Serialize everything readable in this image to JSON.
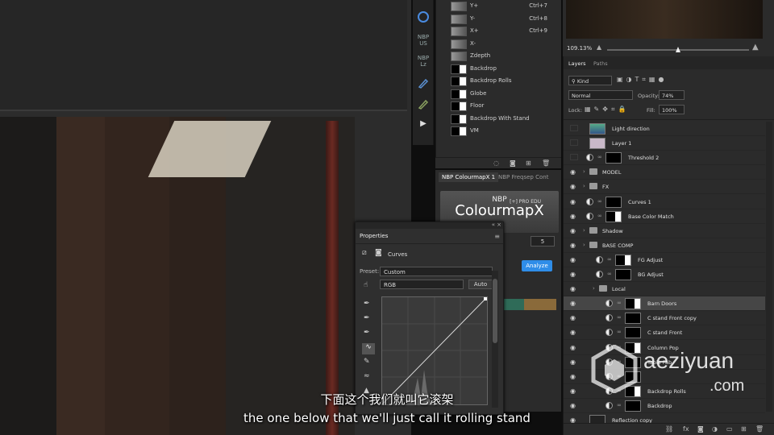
{
  "channels": [
    {
      "name": "Y+",
      "key": "Ctrl+7"
    },
    {
      "name": "Y-",
      "key": "Ctrl+8"
    },
    {
      "name": "X+",
      "key": "Ctrl+9"
    },
    {
      "name": "X-",
      "key": ""
    },
    {
      "name": "Zdepth",
      "key": ""
    },
    {
      "name": "Backdrop",
      "key": ""
    },
    {
      "name": "Backdrop Rolls",
      "key": ""
    },
    {
      "name": "Globe",
      "key": ""
    },
    {
      "name": "Floor",
      "key": ""
    },
    {
      "name": "Backdrop With Stand",
      "key": ""
    },
    {
      "name": "VM",
      "key": ""
    }
  ],
  "strip_tools": [
    "NBP US",
    "NBP Lz"
  ],
  "nbp": {
    "tab1": "NBP ColourmapX 1",
    "tab2": "NBP Freqsep Cont",
    "logo_top": "NBP",
    "logo_main": "ColourmapX",
    "logo_badge": "[+] PRO EDU",
    "value": "5",
    "analyze": "Analyze"
  },
  "properties": {
    "title": "Properties",
    "type": "Curves",
    "preset_label": "Preset:",
    "preset_value": "Custom",
    "channel": "RGB",
    "auto": "Auto"
  },
  "navigator": {
    "zoom": "109.13%"
  },
  "layers_panel": {
    "tab_layers": "Layers",
    "tab_paths": "Paths",
    "kind": "Kind",
    "blend": "Normal",
    "opacity_label": "Opacity:",
    "opacity": "74%",
    "lock_label": "Lock:",
    "fill_label": "Fill:",
    "fill": "100%"
  },
  "layers": [
    {
      "name": "Light direction",
      "indent": 0,
      "kind": "image",
      "visible": false
    },
    {
      "name": "Layer 1",
      "indent": 0,
      "kind": "image",
      "visible": false
    },
    {
      "name": "Threshold 2",
      "indent": 0,
      "kind": "adj",
      "visible": false
    },
    {
      "name": "MODEL",
      "indent": 0,
      "kind": "folder",
      "visible": true
    },
    {
      "name": "FX",
      "indent": 0,
      "kind": "folder",
      "visible": true
    },
    {
      "name": "Curves 1",
      "indent": 0,
      "kind": "adj",
      "visible": true
    },
    {
      "name": "Base Color Match",
      "indent": 0,
      "kind": "adj",
      "visible": true
    },
    {
      "name": "Shadow",
      "indent": 0,
      "kind": "folder",
      "visible": true
    },
    {
      "name": "BASE COMP",
      "indent": 0,
      "kind": "folder",
      "visible": true
    },
    {
      "name": "FG Adjust",
      "indent": 1,
      "kind": "adj",
      "visible": true
    },
    {
      "name": "BG Adjust",
      "indent": 1,
      "kind": "adj",
      "visible": true
    },
    {
      "name": "Local",
      "indent": 1,
      "kind": "folder",
      "visible": true
    },
    {
      "name": "Barn Doors",
      "indent": 2,
      "kind": "adj",
      "visible": true,
      "selected": true
    },
    {
      "name": "C stand Front copy",
      "indent": 2,
      "kind": "adj",
      "visible": true
    },
    {
      "name": "C stand Front",
      "indent": 2,
      "kind": "adj",
      "visible": true
    },
    {
      "name": "Column Pop",
      "indent": 2,
      "kind": "adj",
      "visible": true
    },
    {
      "name": "Table Fab",
      "indent": 2,
      "kind": "adj",
      "visible": true
    },
    {
      "name": "",
      "indent": 2,
      "kind": "adj",
      "visible": true
    },
    {
      "name": "Backdrop Rolls",
      "indent": 2,
      "kind": "adj",
      "visible": true
    },
    {
      "name": "Backdrop",
      "indent": 2,
      "kind": "adj",
      "visible": true
    },
    {
      "name": "Reflection copy",
      "indent": 0,
      "kind": "image",
      "visible": true
    }
  ],
  "subtitles": {
    "cn": "下面这个我们就叫它滚架",
    "en": "the one below that we'll just call it rolling stand"
  },
  "watermark": {
    "line1": "aeziyuan",
    "line2": ".com"
  }
}
